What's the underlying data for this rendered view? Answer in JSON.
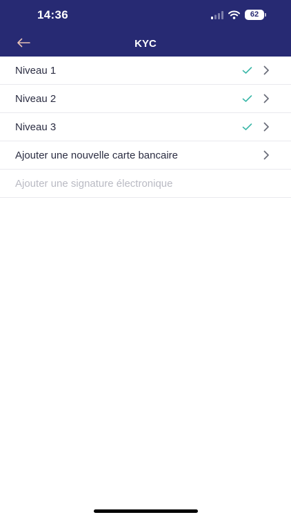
{
  "status_bar": {
    "time": "14:36",
    "battery": "62"
  },
  "nav": {
    "title": "KYC"
  },
  "colors": {
    "header_bg": "#272a73",
    "check": "#3ab7a8",
    "text": "#2b2d42",
    "disabled_text": "#b9bac3",
    "chevron": "#6b6e7a"
  },
  "items": [
    {
      "label": "Niveau 1",
      "checked": true,
      "chevron": true,
      "disabled": false
    },
    {
      "label": "Niveau 2",
      "checked": true,
      "chevron": true,
      "disabled": false
    },
    {
      "label": "Niveau 3",
      "checked": true,
      "chevron": true,
      "disabled": false
    },
    {
      "label": "Ajouter une nouvelle carte bancaire",
      "checked": false,
      "chevron": true,
      "disabled": false
    },
    {
      "label": "Ajouter une signature électronique",
      "checked": false,
      "chevron": false,
      "disabled": true
    }
  ]
}
